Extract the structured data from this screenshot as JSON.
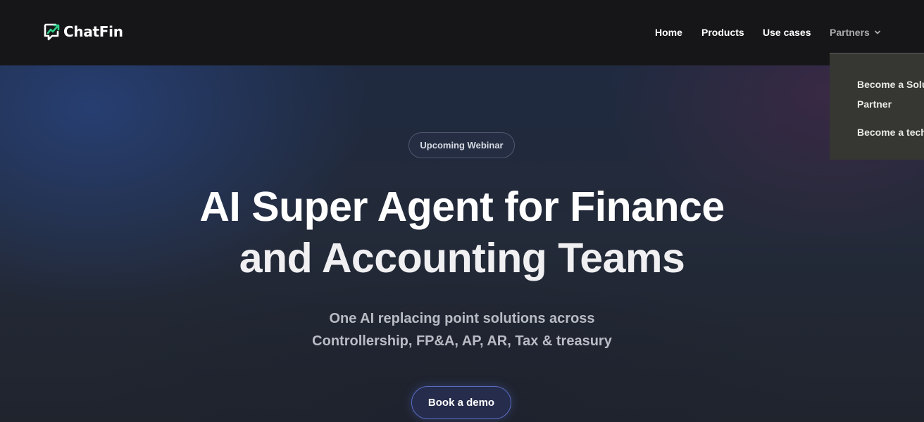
{
  "brand": {
    "name": "ChatFin",
    "logo_icon": "chatfin-logo-icon",
    "accent_color": "#2fd08a"
  },
  "nav": {
    "home": "Home",
    "products": "Products",
    "use_cases": "Use cases",
    "partners": "Partners",
    "partners_icon": "chevron-down-icon"
  },
  "partners_dropdown": {
    "items": [
      {
        "label_line1": "Become a Solution",
        "label_line2": "Partner"
      },
      {
        "label_line1": "Become a technology partner"
      }
    ]
  },
  "hero": {
    "pill_label": "Upcoming Webinar",
    "headline_line1": "AI Super Agent for Finance",
    "headline_line2": "and Accounting Teams",
    "subhead_line1": "One AI replacing point solutions across",
    "subhead_line2": "Controllership, FP&A, AP, AR, Tax & treasury",
    "cta_label": "Book a demo"
  }
}
